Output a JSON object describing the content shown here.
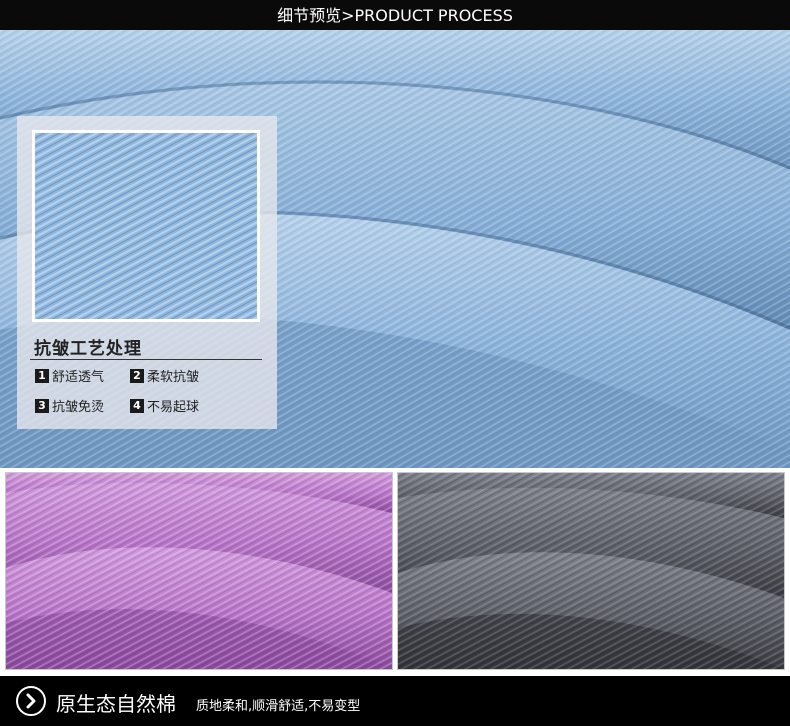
{
  "header": {
    "title": "细节预览>PRODUCT PROCESS"
  },
  "hero": {
    "fabric_color": "light blue",
    "colors": {
      "base": "#86aed6",
      "light": "#a9c7e4",
      "dark": "#5f88b3"
    }
  },
  "feature_panel": {
    "title": "抗皱工艺处理",
    "features": [
      {
        "num": "1",
        "label": "舒适透气"
      },
      {
        "num": "2",
        "label": "柔软抗皱"
      },
      {
        "num": "3",
        "label": "抗皱免烫"
      },
      {
        "num": "4",
        "label": "不易起球"
      }
    ]
  },
  "swatches": [
    {
      "name": "purple",
      "colors": {
        "base": "#b774c7",
        "light": "#d19bdc",
        "dark": "#8a4a9c"
      }
    },
    {
      "name": "gray",
      "colors": {
        "base": "#5d6068",
        "light": "#7e828b",
        "dark": "#3a3c42"
      }
    }
  ],
  "footer": {
    "icon": "arrow-right-circle-icon",
    "title": "原生态自然棉",
    "description": "质地柔和,顺滑舒适,不易变型"
  }
}
